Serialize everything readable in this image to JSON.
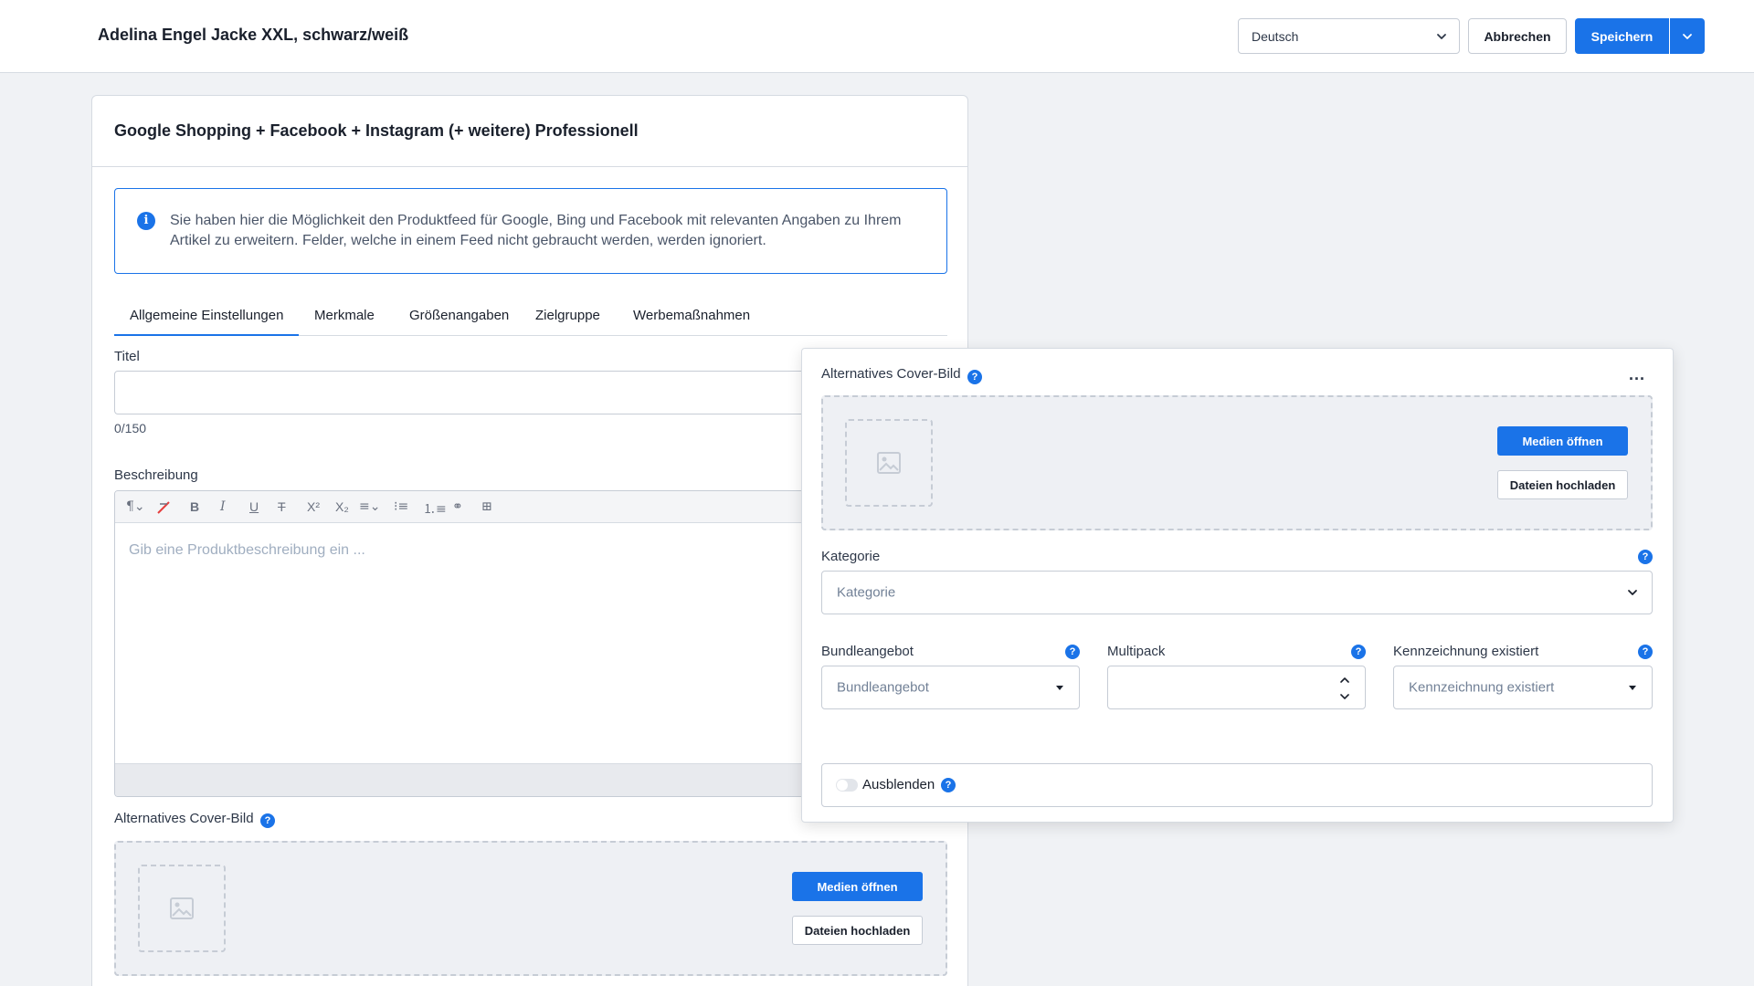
{
  "header": {
    "title": "Adelina Engel Jacke XXL, schwarz/weiß",
    "language": "Deutsch",
    "cancel_label": "Abbrechen",
    "save_label": "Speichern"
  },
  "card": {
    "title": "Google Shopping + Facebook + Instagram (+ weitere) Professionell",
    "info_text": "Sie haben hier die Möglichkeit den Produktfeed für Google, Bing und Facebook mit relevanten Angaben zu Ihrem Artikel zu erweitern. Felder, welche in einem Feed nicht gebraucht werden, werden ignoriert.",
    "tabs": [
      {
        "label": "Allgemeine Einstellungen",
        "active": true
      },
      {
        "label": "Merkmale",
        "active": false
      },
      {
        "label": "Größenangaben",
        "active": false
      },
      {
        "label": "Zielgruppe",
        "active": false
      },
      {
        "label": "Werbemaßnahmen",
        "active": false
      }
    ],
    "title_field": {
      "label": "Titel",
      "value": "",
      "counter": "0/150"
    },
    "description": {
      "label": "Beschreibung",
      "placeholder": "Gib eine Produktbeschreibung ein ..."
    },
    "cover": {
      "label": "Alternatives Cover-Bild",
      "open_media": "Medien öffnen",
      "upload": "Dateien hochladen"
    }
  },
  "panel": {
    "cover_label": "Alternatives Cover-Bild",
    "more_label": "...",
    "open_media": "Medien öffnen",
    "upload": "Dateien hochladen",
    "category": {
      "label": "Kategorie",
      "placeholder": "Kategorie"
    },
    "bundle": {
      "label": "Bundleangebot",
      "placeholder": "Bundleangebot"
    },
    "multipack": {
      "label": "Multipack",
      "value": ""
    },
    "marking": {
      "label": "Kennzeichnung existiert",
      "placeholder": "Kennzeichnung existiert"
    },
    "hide": {
      "label": "Ausblenden",
      "enabled": false
    }
  },
  "help_glyph": "?",
  "info_glyph": "i",
  "colors": {
    "accent": "#1a73e8",
    "border": "#c6ccd5",
    "bg": "#f0f2f5"
  }
}
